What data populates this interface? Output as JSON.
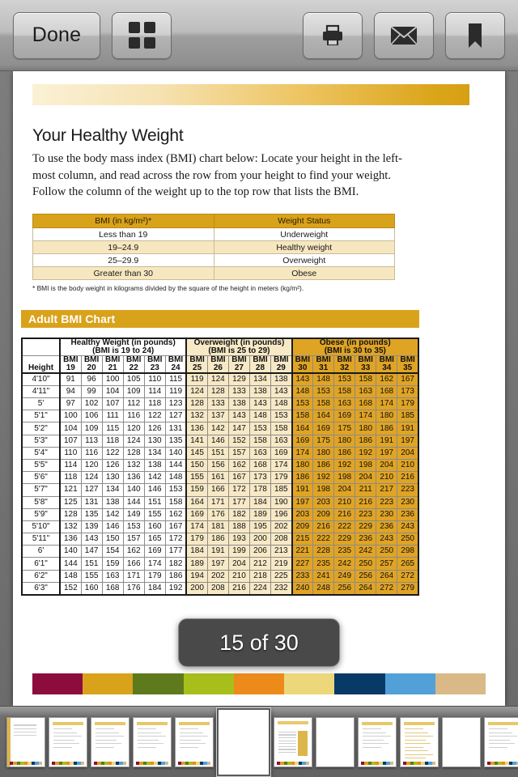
{
  "toolbar": {
    "done_label": "Done",
    "grid_icon": "grid-thumbnails-icon",
    "print_icon": "print-icon",
    "mail_icon": "mail-envelope-icon",
    "bookmark_icon": "bookmark-icon"
  },
  "page_indicator": {
    "text": "15 of 30",
    "current": 15,
    "total": 30
  },
  "document": {
    "title": "Your Healthy Weight",
    "intro": "To use the body mass index (BMI) chart below: Locate your height in the left-most column, and read across the row from your height to find your weight. Follow the column of the weight up to the top row that lists the BMI.",
    "footnote": "* BMI is the body weight in kilograms divided by the square of the height in meters (kg/m²).",
    "chart_title": "Adult BMI Chart"
  },
  "status_table": {
    "headers": [
      "BMI (in kg/m²)*",
      "Weight Status"
    ],
    "rows": [
      [
        "Less than 19",
        "Underweight"
      ],
      [
        "19–24.9",
        "Healthy weight"
      ],
      [
        "25–29.9",
        "Overweight"
      ],
      [
        "Greater than 30",
        "Obese"
      ]
    ]
  },
  "chart_data": {
    "type": "table",
    "title": "Adult BMI Chart",
    "xlabel": "BMI",
    "ylabel": "Height",
    "height_header": "Height",
    "groups": [
      {
        "name": "Healthy Weight (in pounds)",
        "subtitle": "(BMI is 19 to 24)",
        "fill": "#ffffff",
        "bmi": [
          19,
          20,
          21,
          22,
          23,
          24
        ]
      },
      {
        "name": "Overweight (in pounds)",
        "subtitle": "(BMI is 25 to 29)",
        "fill": "#f7e9c6",
        "bmi": [
          25,
          26,
          27,
          28,
          29
        ]
      },
      {
        "name": "Obese (in pounds)",
        "subtitle": "(BMI is 30 to 35)",
        "fill": "#e0a424",
        "bmi": [
          30,
          31,
          32,
          33,
          34,
          35
        ]
      }
    ],
    "column_headers": [
      "BMI 19",
      "BMI 20",
      "BMI 21",
      "BMI 22",
      "BMI 23",
      "BMI 24",
      "BMI 25",
      "BMI 26",
      "BMI 27",
      "BMI 28",
      "BMI 29",
      "BMI 30",
      "BMI 31",
      "BMI 32",
      "BMI 33",
      "BMI 34",
      "BMI 35"
    ],
    "heights": [
      "4'10\"",
      "4'11\"",
      "5'",
      "5'1\"",
      "5'2\"",
      "5'3\"",
      "5'4\"",
      "5'5\"",
      "5'6\"",
      "5'7\"",
      "5'8\"",
      "5'9\"",
      "5'10\"",
      "5'11\"",
      "6'",
      "6'1\"",
      "6'2\"",
      "6'3\""
    ],
    "rows": [
      {
        "height": "4'10\"",
        "values": [
          91,
          96,
          100,
          105,
          110,
          115,
          119,
          124,
          129,
          134,
          138,
          143,
          148,
          153,
          158,
          162,
          167
        ]
      },
      {
        "height": "4'11\"",
        "values": [
          94,
          99,
          104,
          109,
          114,
          119,
          124,
          128,
          133,
          138,
          143,
          148,
          153,
          158,
          163,
          168,
          173
        ]
      },
      {
        "height": "5'",
        "values": [
          97,
          102,
          107,
          112,
          118,
          123,
          128,
          133,
          138,
          143,
          148,
          153,
          158,
          163,
          168,
          174,
          179
        ]
      },
      {
        "height": "5'1\"",
        "values": [
          100,
          106,
          111,
          116,
          122,
          127,
          132,
          137,
          143,
          148,
          153,
          158,
          164,
          169,
          174,
          180,
          185
        ]
      },
      {
        "height": "5'2\"",
        "values": [
          104,
          109,
          115,
          120,
          126,
          131,
          136,
          142,
          147,
          153,
          158,
          164,
          169,
          175,
          180,
          186,
          191
        ]
      },
      {
        "height": "5'3\"",
        "values": [
          107,
          113,
          118,
          124,
          130,
          135,
          141,
          146,
          152,
          158,
          163,
          169,
          175,
          180,
          186,
          191,
          197
        ]
      },
      {
        "height": "5'4\"",
        "values": [
          110,
          116,
          122,
          128,
          134,
          140,
          145,
          151,
          157,
          163,
          169,
          174,
          180,
          186,
          192,
          197,
          204
        ]
      },
      {
        "height": "5'5\"",
        "values": [
          114,
          120,
          126,
          132,
          138,
          144,
          150,
          156,
          162,
          168,
          174,
          180,
          186,
          192,
          198,
          204,
          210
        ]
      },
      {
        "height": "5'6\"",
        "values": [
          118,
          124,
          130,
          136,
          142,
          148,
          155,
          161,
          167,
          173,
          179,
          186,
          192,
          198,
          204,
          210,
          216
        ]
      },
      {
        "height": "5'7\"",
        "values": [
          121,
          127,
          134,
          140,
          146,
          153,
          159,
          166,
          172,
          178,
          185,
          191,
          198,
          204,
          211,
          217,
          223
        ]
      },
      {
        "height": "5'8\"",
        "values": [
          125,
          131,
          138,
          144,
          151,
          158,
          164,
          171,
          177,
          184,
          190,
          197,
          203,
          210,
          216,
          223,
          230
        ]
      },
      {
        "height": "5'9\"",
        "values": [
          128,
          135,
          142,
          149,
          155,
          162,
          169,
          176,
          182,
          189,
          196,
          203,
          209,
          216,
          223,
          230,
          236
        ]
      },
      {
        "height": "5'10\"",
        "values": [
          132,
          139,
          146,
          153,
          160,
          167,
          174,
          181,
          188,
          195,
          202,
          209,
          216,
          222,
          229,
          236,
          243
        ]
      },
      {
        "height": "5'11\"",
        "values": [
          136,
          143,
          150,
          157,
          165,
          172,
          179,
          186,
          193,
          200,
          208,
          215,
          222,
          229,
          236,
          243,
          250
        ]
      },
      {
        "height": "6'",
        "values": [
          140,
          147,
          154,
          162,
          169,
          177,
          184,
          191,
          199,
          206,
          213,
          221,
          228,
          235,
          242,
          250,
          298
        ]
      },
      {
        "height": "6'1\"",
        "values": [
          144,
          151,
          159,
          166,
          174,
          182,
          189,
          197,
          204,
          212,
          219,
          227,
          235,
          242,
          250,
          257,
          265
        ]
      },
      {
        "height": "6'2\"",
        "values": [
          148,
          155,
          163,
          171,
          179,
          186,
          194,
          202,
          210,
          218,
          225,
          233,
          241,
          249,
          256,
          264,
          272
        ]
      },
      {
        "height": "6'3\"",
        "values": [
          152,
          160,
          168,
          176,
          184,
          192,
          200,
          208,
          216,
          224,
          232,
          240,
          248,
          256,
          264,
          272,
          279
        ]
      }
    ]
  },
  "color_strip": [
    "#8d0c3e",
    "#d9a21b",
    "#5f7a1c",
    "#a8bf1b",
    "#ec8a1a",
    "#ecd87a",
    "#073a67",
    "#52a0d8",
    "#d9b987"
  ],
  "filmstrip": {
    "selected_index": 5,
    "thumbnails": [
      {
        "name": "page-thumbnail-1",
        "kind": "cover"
      },
      {
        "name": "page-thumbnail-2",
        "kind": "text"
      },
      {
        "name": "page-thumbnail-3",
        "kind": "text"
      },
      {
        "name": "page-thumbnail-4",
        "kind": "text"
      },
      {
        "name": "page-thumbnail-5",
        "kind": "text"
      },
      {
        "name": "page-thumbnail-6",
        "kind": "blank"
      },
      {
        "name": "page-thumbnail-7",
        "kind": "chart"
      },
      {
        "name": "page-thumbnail-8",
        "kind": "blank"
      },
      {
        "name": "page-thumbnail-9",
        "kind": "text"
      },
      {
        "name": "page-thumbnail-10",
        "kind": "lines"
      },
      {
        "name": "page-thumbnail-11",
        "kind": "blank"
      },
      {
        "name": "page-thumbnail-12",
        "kind": "form"
      },
      {
        "name": "page-thumbnail-13",
        "kind": "blank"
      }
    ]
  }
}
